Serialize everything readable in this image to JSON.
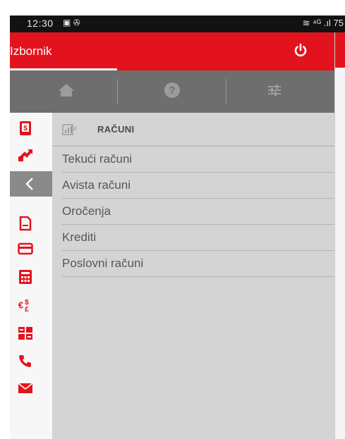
{
  "status_bar": {
    "time": "12:30",
    "left_icons": "▣ ✇",
    "right": "≋ ⁴ᴳ .ıl 75"
  },
  "header": {
    "title": "Izbornik"
  },
  "icons": {
    "power": "power-icon",
    "home": "home-icon",
    "help": "help-icon",
    "settings": "sliders-icon",
    "sidebar": [
      "account-icon",
      "transfer-icon",
      "back-icon",
      "document-icon",
      "card-icon",
      "calculator-icon",
      "exchange-icon",
      "atm-icon",
      "phone-icon",
      "mail-icon"
    ]
  },
  "colors": {
    "brand_red": "#e3131e",
    "tab_bar": "#6e6e6e",
    "content_bg": "#d4d4d4"
  },
  "section": {
    "title": "RAČUNI"
  },
  "menu": [
    {
      "label": "Tekući računi"
    },
    {
      "label": "Avista računi"
    },
    {
      "label": "Oročenja"
    },
    {
      "label": "Krediti"
    },
    {
      "label": "Poslovni računi"
    }
  ]
}
